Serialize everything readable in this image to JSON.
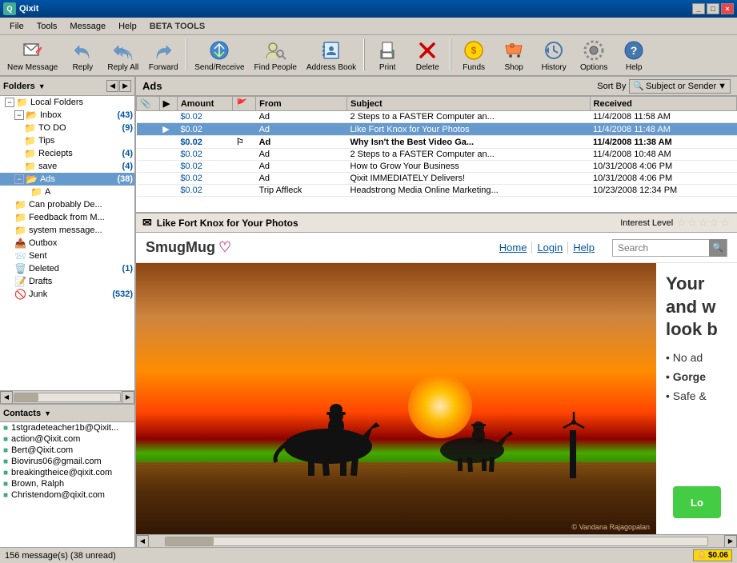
{
  "titleBar": {
    "title": "Qixit",
    "icon": "Q",
    "buttons": [
      "_",
      "□",
      "×"
    ]
  },
  "menuBar": {
    "items": [
      "File",
      "Tools",
      "Message",
      "Help"
    ],
    "betaTools": "BETA TOOLS"
  },
  "toolbar": {
    "buttons": [
      {
        "id": "new-message",
        "label": "New Message",
        "icon": "✉"
      },
      {
        "id": "reply",
        "label": "Reply",
        "icon": "↩"
      },
      {
        "id": "reply-all",
        "label": "Reply All",
        "icon": "↩↩"
      },
      {
        "id": "forward",
        "label": "Forward",
        "icon": "↪"
      },
      {
        "id": "send-receive",
        "label": "Send/Receive",
        "icon": "⇄"
      },
      {
        "id": "find-people",
        "label": "Find People",
        "icon": "👤"
      },
      {
        "id": "address-book",
        "label": "Address Book",
        "icon": "📒"
      },
      {
        "id": "print",
        "label": "Print",
        "icon": "🖨"
      },
      {
        "id": "delete",
        "label": "Delete",
        "icon": "✖"
      },
      {
        "id": "funds",
        "label": "Funds",
        "icon": "💰"
      },
      {
        "id": "shop",
        "label": "Shop",
        "icon": "🛒"
      },
      {
        "id": "history",
        "label": "History",
        "icon": "🕐"
      },
      {
        "id": "options",
        "label": "Options",
        "icon": "⚙"
      },
      {
        "id": "help",
        "label": "Help",
        "icon": "?"
      }
    ]
  },
  "foldersPanel": {
    "title": "Folders",
    "folders": [
      {
        "id": "local",
        "label": "Local Folders",
        "indent": 1,
        "type": "root",
        "expanded": true
      },
      {
        "id": "inbox",
        "label": "Inbox",
        "count": "(43)",
        "indent": 2,
        "type": "folder",
        "expanded": true
      },
      {
        "id": "todo",
        "label": "TO DO",
        "count": "(9)",
        "indent": 3,
        "type": "subfolder"
      },
      {
        "id": "tips",
        "label": "Tips",
        "indent": 3,
        "type": "subfolder"
      },
      {
        "id": "reciepts",
        "label": "Reciepts",
        "count": "(4)",
        "indent": 3,
        "type": "subfolder"
      },
      {
        "id": "save",
        "label": "save",
        "count": "(4)",
        "indent": 3,
        "type": "subfolder"
      },
      {
        "id": "ads",
        "label": "Ads",
        "count": "(38)",
        "indent": 3,
        "type": "subfolder",
        "selected": true
      },
      {
        "id": "a",
        "label": "A",
        "indent": 4,
        "type": "subfolder"
      },
      {
        "id": "canprobably",
        "label": "Can probably De...",
        "indent": 2,
        "type": "subfolder"
      },
      {
        "id": "feedback",
        "label": "Feedback from M...",
        "indent": 2,
        "type": "subfolder"
      },
      {
        "id": "systemmsg",
        "label": "system message...",
        "indent": 2,
        "type": "subfolder"
      },
      {
        "id": "outbox",
        "label": "Outbox",
        "indent": 1,
        "type": "folder"
      },
      {
        "id": "sent",
        "label": "Sent",
        "indent": 1,
        "type": "folder"
      },
      {
        "id": "deleted",
        "label": "Deleted",
        "count": "(1)",
        "indent": 1,
        "type": "folder"
      },
      {
        "id": "drafts",
        "label": "Drafts",
        "indent": 1,
        "type": "folder"
      },
      {
        "id": "junk",
        "label": "Junk",
        "count": "(532)",
        "indent": 1,
        "type": "folder"
      }
    ]
  },
  "contactsPanel": {
    "title": "Contacts",
    "contacts": [
      {
        "email": "1stgradeteacher1b@Qixit..."
      },
      {
        "email": "action@Qixit.com"
      },
      {
        "email": "Bert@Qixit.com"
      },
      {
        "email": "Biovirus06@gmail.com"
      },
      {
        "email": "breakingtheice@qixit.com"
      },
      {
        "email": "Brown, Ralph"
      },
      {
        "email": "Christendom@qixit.com"
      }
    ]
  },
  "emailList": {
    "folderName": "Ads",
    "sortBy": "Sort By",
    "sortOptions": "Subject or Sender",
    "columns": [
      "",
      "",
      "Amount",
      "",
      "From",
      "Subject",
      "Received"
    ],
    "emails": [
      {
        "attach": false,
        "unread": false,
        "amount": "$0.02",
        "flag": "",
        "from": "Ad",
        "subject": "2 Steps to a FASTER Computer an...",
        "received": "11/4/2008 11:58 AM"
      },
      {
        "attach": false,
        "unread": false,
        "amount": "$0.02",
        "flag": "",
        "from": "Ad",
        "subject": "Like Fort Knox for Your Photos",
        "received": "11/4/2008 11:48 AM",
        "selected": true
      },
      {
        "attach": false,
        "unread": true,
        "amount": "$0.02",
        "flag": "⚐",
        "from": "Ad",
        "subject": "Why Isn't the Best Video Ga...",
        "received": "11/4/2008 11:38 AM"
      },
      {
        "attach": false,
        "unread": false,
        "amount": "$0.02",
        "flag": "",
        "from": "Ad",
        "subject": "2 Steps to a FASTER Computer an...",
        "received": "11/4/2008 10:48 AM"
      },
      {
        "attach": false,
        "unread": false,
        "amount": "$0.02",
        "flag": "",
        "from": "Ad",
        "subject": "How to Grow Your Business",
        "received": "10/31/2008 4:06 PM"
      },
      {
        "attach": false,
        "unread": false,
        "amount": "$0.02",
        "flag": "",
        "from": "Ad",
        "subject": "Qixit IMMEDIATELY Delivers!",
        "received": "10/31/2008 4:06 PM"
      },
      {
        "attach": false,
        "unread": false,
        "amount": "$0.02",
        "flag": "",
        "from": "Trip Affleck",
        "subject": "Headstrong Media Online Marketing...",
        "received": "10/23/2008 12:34 PM"
      }
    ]
  },
  "previewPane": {
    "title": "Like Fort Knox for Your Photos",
    "interestLabel": "Interest Level",
    "stars": "☆☆☆☆☆"
  },
  "smugMug": {
    "logo": "SmugMug",
    "logoIcon": "♡",
    "nav": [
      "Home",
      "Login",
      "Help"
    ],
    "searchPlaceholder": "Search",
    "searchLabel": "Search",
    "headline1": "Your",
    "headline2": "and w",
    "headline3": "look b",
    "bullets": [
      "• No ad",
      "• Gorge",
      "• Safe &"
    ],
    "copyright": "© Vandana Rajagopalan",
    "ctaLabel": "Lo"
  },
  "statusBar": {
    "messageCount": "156 message(s) (38 unread)",
    "funds": "$0.06"
  }
}
